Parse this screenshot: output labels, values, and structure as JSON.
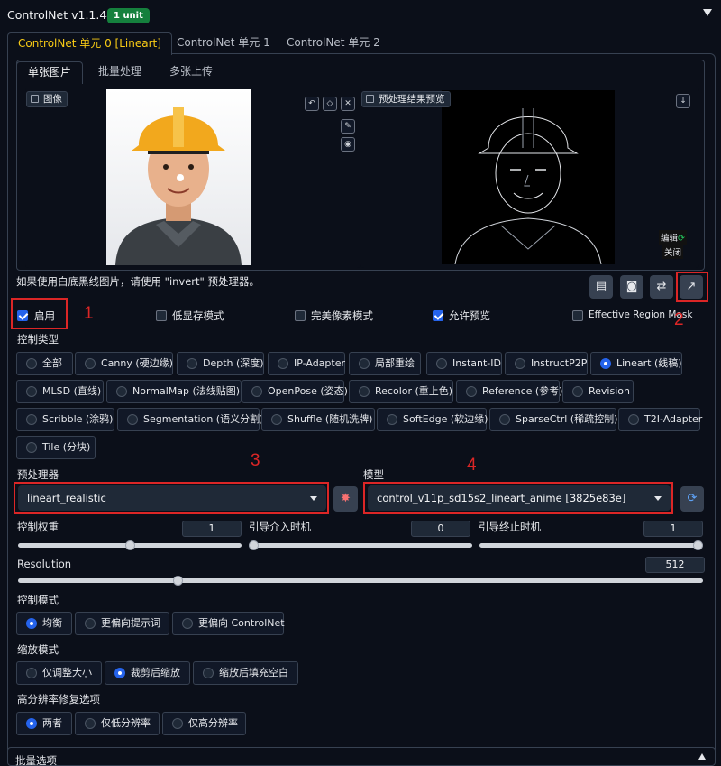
{
  "header": {
    "title": "ControlNet v1.1.448",
    "badge": "1 unit",
    "collapse_icon": "triangle-down-icon"
  },
  "unit_tabs": [
    {
      "label": "ControlNet 单元 0 [Lineart]",
      "active": true
    },
    {
      "label": "ControlNet 单元 1",
      "active": false
    },
    {
      "label": "ControlNet 单元 2",
      "active": false
    }
  ],
  "input_tabs": [
    {
      "label": "单张图片",
      "active": true
    },
    {
      "label": "批量处理",
      "active": false
    },
    {
      "label": "多张上传",
      "active": false
    }
  ],
  "image_panel": {
    "label": "图像",
    "tools": [
      "undo-icon",
      "eraser-icon",
      "close-icon",
      "brush-icon",
      "color-icon"
    ]
  },
  "preview_panel": {
    "label": "预处理结果预览",
    "edit_label": "编辑",
    "close_label": "关闭",
    "download_icon": "download-icon"
  },
  "hint": "如果使用白底黑线图片，请使用 \"invert\" 预处理器。",
  "action_buttons": [
    "document-icon",
    "camera-icon",
    "swap-icon",
    "send-icon"
  ],
  "checkboxes": [
    {
      "label": "启用",
      "checked": true
    },
    {
      "label": "低显存模式",
      "checked": false
    },
    {
      "label": "完美像素模式",
      "checked": false
    },
    {
      "label": "允许预览",
      "checked": true
    },
    {
      "label": "Effective Region Mask",
      "checked": false
    }
  ],
  "control_type": {
    "label": "控制类型",
    "options": [
      "全部",
      "Canny (硬边缘)",
      "Depth (深度)",
      "IP-Adapter",
      "局部重绘",
      "Instant-ID",
      "InstructP2P",
      "Lineart (线稿)",
      "MLSD (直线)",
      "NormalMap (法线贴图)",
      "OpenPose (姿态)",
      "Recolor (重上色)",
      "Reference (参考)",
      "Revision",
      "Scribble (涂鸦)",
      "Segmentation (语义分割)",
      "Shuffle (随机洗牌)",
      "SoftEdge (软边缘)",
      "SparseCtrl (稀疏控制)",
      "T2I-Adapter",
      "Tile (分块)"
    ],
    "selected": "Lineart (线稿)"
  },
  "preprocessor": {
    "label": "预处理器",
    "value": "lineart_realistic",
    "run_icon": "explosion-icon"
  },
  "model": {
    "label": "模型",
    "value": "control_v11p_sd15s2_lineart_anime [3825e83e]",
    "refresh_icon": "refresh-icon"
  },
  "sliders": {
    "weight": {
      "label": "控制权重",
      "value": "1",
      "fraction": 0.5
    },
    "start": {
      "label": "引导介入时机",
      "value": "0",
      "fraction": 0.0
    },
    "end": {
      "label": "引导终止时机",
      "value": "1",
      "fraction": 1.0
    },
    "resolution": {
      "label": "Resolution",
      "value": "512",
      "fraction": 0.23
    }
  },
  "control_mode": {
    "label": "控制模式",
    "options": [
      "均衡",
      "更偏向提示词",
      "更偏向 ControlNet"
    ],
    "selected": "均衡"
  },
  "resize_mode": {
    "label": "缩放模式",
    "options": [
      "仅调整大小",
      "裁剪后缩放",
      "缩放后填充空白"
    ],
    "selected": "裁剪后缩放"
  },
  "hires_fix": {
    "label": "高分辨率修复选项",
    "options": [
      "两者",
      "仅低分辨率",
      "仅高分辨率"
    ],
    "selected": "两者"
  },
  "annotations": [
    "1",
    "2",
    "3",
    "4"
  ],
  "footer": {
    "label": "批量选项"
  },
  "colors": {
    "accent": "#2563eb",
    "active_tab": "#facc15",
    "badge": "#15803d",
    "annotation": "#dc2626"
  }
}
